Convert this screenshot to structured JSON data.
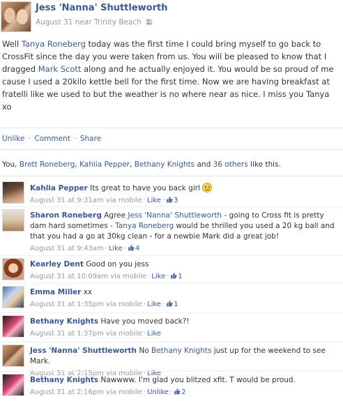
{
  "post": {
    "author": "Jess 'Nanna' Shuttleworth",
    "meta": "August 31 near Trinity Beach",
    "text_parts": {
      "p1": "Well ",
      "link1": "Tanya Roneberg",
      "p2": " today was the first time I could bring myself to go back to CrossFit since the day you were taken from us. You will be pleased to know that I dragged ",
      "link2": "Mark Scott",
      "p3": " along and he actually enjoyed it. You would be so proud of me cause I used a 20kilo kettle bell for the first time. Now we are having breakfast at fratelli like we used to but the weather is no where near as nice. I miss you Tanya xo"
    }
  },
  "actions": {
    "unlike": "Unlike",
    "comment": "Comment",
    "share": "Share",
    "sep": "·"
  },
  "likes": {
    "you": "You, ",
    "person1": "Brett Roneberg",
    "comma1": ", ",
    "person2": "Kahlia Pepper",
    "comma2": ", ",
    "person3": "Bethany Knights",
    "and": " and ",
    "others": "36 others",
    "tail": " like this."
  },
  "comments": [
    {
      "author": "Kahlia Pepper",
      "text": "Its great to have you back girl",
      "has_smiley": true,
      "time": "August 31 at 9:31am via mobile",
      "action": "Like",
      "likes": "3"
    },
    {
      "author": "Sharon Roneberg",
      "text_a": "Agree ",
      "link_a": "Jess 'Nanna' Shuttleworth",
      "text_b": " - going to Cross fit is pretty dam hard sometimes - ",
      "link_b": "Tanya Roneberg",
      "text_c": " would be thrilled you used a 20 kg ball and that you had a go at 30kg clean - for a newbie Mark did a great job!",
      "time": "August 31 at 9:43am",
      "action": "Like",
      "likes": "4"
    },
    {
      "author": "Kearley Dent",
      "text": "Good on you jess",
      "time": "August 31 at 10:09am via mobile",
      "action": "Like",
      "likes": "1"
    },
    {
      "author": "Emma Miller",
      "text": "xx",
      "time": "August 31 at 1:35pm via mobile",
      "action": "Like",
      "likes": "1"
    },
    {
      "author": "Bethany Knights",
      "text": "Have you moved back?!",
      "time": "August 31 at 1:37pm via mobile",
      "action": "Like"
    },
    {
      "author": "Jess 'Nanna' Shuttleworth",
      "text_a": "No ",
      "link_a": "Bethany Knights",
      "text_b": " just up for the weekend to see Mark.",
      "time": "August 31 at 2:15pm via mobile",
      "action": "Like"
    },
    {
      "author": "Bethany Knights",
      "text": "Nawwww. I'm glad you blitzed xfit. T would be proud.",
      "time": "August 31 at 2:16pm via mobile",
      "action": "Unlike",
      "likes": "2"
    }
  ]
}
